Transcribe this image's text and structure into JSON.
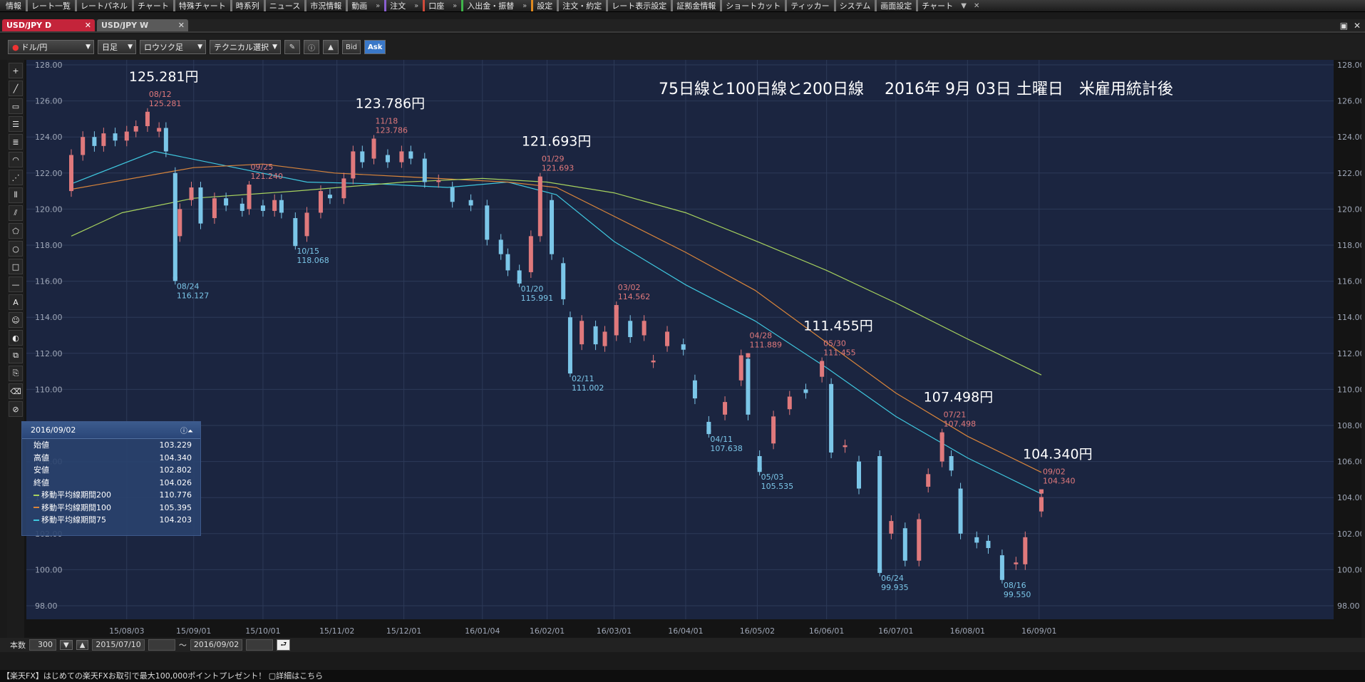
{
  "menu": [
    "情報",
    "レート一覧",
    "レートパネル",
    "チャート",
    "特殊チャート",
    "時系列",
    "ニュース",
    "市況情報",
    "動画",
    "注文",
    "口座",
    "入出金・振替",
    "設定",
    "注文・約定",
    "レート表示設定",
    "証拠金情報",
    "ショートカット",
    "ティッカー",
    "システム",
    "画面設定",
    "チャート"
  ],
  "tabs": [
    {
      "label": "USD/JPY D",
      "active": true
    },
    {
      "label": "USD/JPY W",
      "active": false
    }
  ],
  "toolbar": {
    "pair": "ドル/円",
    "period": "日足",
    "chart_kind": "ロウソク足",
    "technical": "テクニカル選択",
    "bid": "Bid",
    "ask": "Ask"
  },
  "chart_data": {
    "type": "candlestick",
    "title": "75日線と100日線と200日線　 2016年 9月 03日 土曜日　米雇用統計後",
    "ylim": [
      97,
      128.5
    ],
    "yticks": [
      "128.00",
      "126.00",
      "124.00",
      "122.00",
      "120.00",
      "118.00",
      "116.00",
      "114.00",
      "112.00",
      "110.00",
      "108.00",
      "106.00",
      "104.00",
      "102.00",
      "100.00",
      "98.00"
    ],
    "xtick_labels": [
      "15/08/03",
      "15/09/01",
      "15/10/01",
      "15/11/02",
      "15/12/01",
      "16/01/04",
      "16/02/01",
      "16/03/01",
      "16/04/01",
      "16/05/02",
      "16/06/01",
      "16/07/01",
      "16/08/01",
      "16/09/01"
    ],
    "x_start": "2015-07-10",
    "x_end": "2016-09-02",
    "colors": {
      "bg": "#1b2540",
      "up": "#e0797c",
      "down": "#7bc6e8",
      "ma75": "#3fc7de",
      "ma100": "#d9853b",
      "ma200": "#a7d25e",
      "grid": "#2d3a58",
      "axis": "#a0a8b8"
    },
    "series": [
      {
        "name": "移動平均線期間75",
        "points": [
          [
            "2015-07-10",
            121.4
          ],
          [
            "2015-08-15",
            123.2
          ],
          [
            "2015-09-15",
            122.4
          ],
          [
            "2015-10-20",
            121.5
          ],
          [
            "2015-11-20",
            121.4
          ],
          [
            "2015-12-20",
            121.2
          ],
          [
            "2016-01-15",
            121.5
          ],
          [
            "2016-02-05",
            120.8
          ],
          [
            "2016-03-01",
            118.2
          ],
          [
            "2016-04-01",
            115.8
          ],
          [
            "2016-05-01",
            113.8
          ],
          [
            "2016-06-01",
            111.2
          ],
          [
            "2016-07-01",
            108.5
          ],
          [
            "2016-08-01",
            106.2
          ],
          [
            "2016-09-02",
            104.2
          ]
        ]
      },
      {
        "name": "移動平均線期間100",
        "points": [
          [
            "2015-07-10",
            121.1
          ],
          [
            "2015-09-01",
            122.3
          ],
          [
            "2015-10-01",
            122.5
          ],
          [
            "2015-11-01",
            122.0
          ],
          [
            "2015-12-01",
            121.8
          ],
          [
            "2016-01-15",
            121.5
          ],
          [
            "2016-02-05",
            121.2
          ],
          [
            "2016-03-01",
            119.6
          ],
          [
            "2016-04-01",
            117.6
          ],
          [
            "2016-05-01",
            115.5
          ],
          [
            "2016-06-01",
            112.6
          ],
          [
            "2016-07-01",
            109.8
          ],
          [
            "2016-08-01",
            107.4
          ],
          [
            "2016-09-02",
            105.4
          ]
        ]
      },
      {
        "name": "移動平均線期間200",
        "points": [
          [
            "2015-07-10",
            118.5
          ],
          [
            "2015-08-01",
            119.8
          ],
          [
            "2015-09-01",
            120.6
          ],
          [
            "2015-10-15",
            121.0
          ],
          [
            "2015-12-01",
            121.5
          ],
          [
            "2016-01-04",
            121.7
          ],
          [
            "2016-02-01",
            121.5
          ],
          [
            "2016-03-01",
            120.9
          ],
          [
            "2016-04-01",
            119.8
          ],
          [
            "2016-05-02",
            118.2
          ],
          [
            "2016-06-01",
            116.6
          ],
          [
            "2016-07-01",
            114.8
          ],
          [
            "2016-08-01",
            112.8
          ],
          [
            "2016-09-02",
            110.8
          ]
        ]
      }
    ],
    "candles": [
      [
        "2015-07-10",
        121.0,
        123.0
      ],
      [
        "2015-07-15",
        123.0,
        124.0
      ],
      [
        "2015-07-20",
        124.0,
        123.5
      ],
      [
        "2015-07-24",
        123.5,
        124.2
      ],
      [
        "2015-07-29",
        124.2,
        123.8
      ],
      [
        "2015-08-03",
        123.8,
        124.3
      ],
      [
        "2015-08-07",
        124.3,
        124.6
      ],
      [
        "2015-08-12",
        124.6,
        125.28
      ],
      [
        "2015-08-17",
        124.3,
        124.5
      ],
      [
        "2015-08-20",
        124.5,
        123.2
      ],
      [
        "2015-08-24",
        122.0,
        116.13
      ],
      [
        "2015-08-26",
        118.5,
        120.0
      ],
      [
        "2015-08-31",
        120.5,
        121.2
      ],
      [
        "2015-09-04",
        121.2,
        119.2
      ],
      [
        "2015-09-10",
        119.5,
        120.6
      ],
      [
        "2015-09-15",
        120.6,
        120.2
      ],
      [
        "2015-09-22",
        120.3,
        119.9
      ],
      [
        "2015-09-25",
        120.0,
        121.24
      ],
      [
        "2015-10-01",
        120.2,
        119.9
      ],
      [
        "2015-10-06",
        119.9,
        120.5
      ],
      [
        "2015-10-09",
        120.5,
        119.8
      ],
      [
        "2015-10-15",
        119.5,
        118.07
      ],
      [
        "2015-10-20",
        118.5,
        119.8
      ],
      [
        "2015-10-26",
        119.8,
        121.0
      ],
      [
        "2015-10-30",
        120.8,
        120.6
      ],
      [
        "2015-11-05",
        120.6,
        121.7
      ],
      [
        "2015-11-09",
        121.7,
        123.2
      ],
      [
        "2015-11-13",
        123.2,
        122.6
      ],
      [
        "2015-11-18",
        122.8,
        123.79
      ],
      [
        "2015-11-24",
        123.0,
        122.6
      ],
      [
        "2015-11-30",
        122.6,
        123.2
      ],
      [
        "2015-12-04",
        123.2,
        122.8
      ],
      [
        "2015-12-10",
        122.8,
        121.5
      ],
      [
        "2015-12-16",
        121.5,
        121.6
      ],
      [
        "2015-12-22",
        121.2,
        120.4
      ],
      [
        "2015-12-30",
        120.5,
        120.2
      ],
      [
        "2016-01-06",
        120.2,
        118.3
      ],
      [
        "2016-01-12",
        118.3,
        117.5
      ],
      [
        "2016-01-15",
        117.5,
        116.6
      ],
      [
        "2016-01-20",
        116.6,
        115.99
      ],
      [
        "2016-01-25",
        116.5,
        118.5
      ],
      [
        "2016-01-29",
        118.5,
        121.69
      ],
      [
        "2016-02-03",
        120.5,
        117.5
      ],
      [
        "2016-02-08",
        117.0,
        115.0
      ],
      [
        "2016-02-11",
        114.0,
        111.0
      ],
      [
        "2016-02-16",
        112.5,
        113.8
      ],
      [
        "2016-02-22",
        113.5,
        112.5
      ],
      [
        "2016-02-26",
        112.4,
        113.2
      ],
      [
        "2016-03-02",
        113.0,
        114.56
      ],
      [
        "2016-03-08",
        113.8,
        112.9
      ],
      [
        "2016-03-14",
        113.0,
        113.8
      ],
      [
        "2016-03-18",
        111.5,
        111.6
      ],
      [
        "2016-03-24",
        112.4,
        113.2
      ],
      [
        "2016-03-31",
        112.5,
        112.2
      ],
      [
        "2016-04-05",
        110.5,
        109.5
      ],
      [
        "2016-04-11",
        108.2,
        107.64
      ],
      [
        "2016-04-18",
        108.6,
        109.3
      ],
      [
        "2016-04-25",
        110.5,
        111.89
      ],
      [
        "2016-04-28",
        111.7,
        108.6
      ],
      [
        "2016-05-03",
        106.3,
        105.54
      ],
      [
        "2016-05-09",
        107.0,
        108.5
      ],
      [
        "2016-05-16",
        108.9,
        109.6
      ],
      [
        "2016-05-23",
        110.0,
        109.8
      ],
      [
        "2016-05-30",
        110.7,
        111.46
      ],
      [
        "2016-06-03",
        110.3,
        106.5
      ],
      [
        "2016-06-09",
        106.8,
        106.9
      ],
      [
        "2016-06-15",
        106.0,
        104.5
      ],
      [
        "2016-06-24",
        106.3,
        99.94
      ],
      [
        "2016-06-29",
        102.0,
        102.7
      ],
      [
        "2016-07-05",
        102.3,
        100.5
      ],
      [
        "2016-07-11",
        100.5,
        102.8
      ],
      [
        "2016-07-15",
        104.6,
        105.3
      ],
      [
        "2016-07-21",
        106.0,
        107.5
      ],
      [
        "2016-07-25",
        106.3,
        105.5
      ],
      [
        "2016-07-29",
        104.5,
        102.0
      ],
      [
        "2016-08-05",
        101.8,
        101.5
      ],
      [
        "2016-08-10",
        101.6,
        101.2
      ],
      [
        "2016-08-16",
        100.8,
        99.55
      ],
      [
        "2016-08-22",
        100.3,
        100.4
      ],
      [
        "2016-08-26",
        100.3,
        101.8
      ],
      [
        "2016-09-02",
        103.23,
        104.03
      ]
    ],
    "annotations": [
      {
        "date": "08/12",
        "value": "125.281",
        "kind": "high",
        "x": "2015-08-12",
        "y": 125.28,
        "big": "125.281円"
      },
      {
        "date": "08/24",
        "value": "116.127",
        "kind": "low",
        "x": "2015-08-24",
        "y": 116.13
      },
      {
        "date": "09/25",
        "value": "121.240",
        "kind": "high",
        "x": "2015-09-25",
        "y": 121.24
      },
      {
        "date": "10/15",
        "value": "118.068",
        "kind": "low",
        "x": "2015-10-15",
        "y": 118.07
      },
      {
        "date": "11/18",
        "value": "123.786",
        "kind": "high",
        "x": "2015-11-18",
        "y": 123.79,
        "big": "123.786円"
      },
      {
        "date": "01/29",
        "value": "121.693",
        "kind": "high",
        "x": "2016-01-29",
        "y": 121.69,
        "big": "121.693円"
      },
      {
        "date": "01/20",
        "value": "115.991",
        "kind": "low",
        "x": "2016-01-20",
        "y": 115.99
      },
      {
        "date": "02/11",
        "value": "111.002",
        "kind": "low",
        "x": "2016-02-11",
        "y": 111.0
      },
      {
        "date": "03/02",
        "value": "114.562",
        "kind": "high",
        "x": "2016-03-02",
        "y": 114.56
      },
      {
        "date": "04/11",
        "value": "107.638",
        "kind": "low",
        "x": "2016-04-11",
        "y": 107.64
      },
      {
        "date": "04/28",
        "value": "111.889",
        "kind": "high",
        "x": "2016-04-28",
        "y": 111.89
      },
      {
        "date": "05/03",
        "value": "105.535",
        "kind": "low",
        "x": "2016-05-03",
        "y": 105.54
      },
      {
        "date": "05/30",
        "value": "111.455",
        "kind": "high",
        "x": "2016-05-30",
        "y": 111.46,
        "big": "111.455円"
      },
      {
        "date": "06/24",
        "value": "99.935",
        "kind": "low",
        "x": "2016-06-24",
        "y": 99.94
      },
      {
        "date": "07/21",
        "value": "107.498",
        "kind": "high",
        "x": "2016-07-21",
        "y": 107.5,
        "big": "107.498円"
      },
      {
        "date": "08/16",
        "value": "99.550",
        "kind": "low",
        "x": "2016-08-16",
        "y": 99.55
      },
      {
        "date": "09/02",
        "value": "104.340",
        "kind": "high",
        "x": "2016-09-02",
        "y": 104.34,
        "big": "104.340円"
      }
    ]
  },
  "infobox": {
    "date": "2016/09/02",
    "rows": [
      {
        "label": "始値",
        "value": "103.229",
        "color": ""
      },
      {
        "label": "高値",
        "value": "104.340",
        "color": ""
      },
      {
        "label": "安値",
        "value": "102.802",
        "color": ""
      },
      {
        "label": "終値",
        "value": "104.026",
        "color": ""
      },
      {
        "label": "移動平均線期間200",
        "value": "110.776",
        "color": "#a7d25e"
      },
      {
        "label": "移動平均線期間100",
        "value": "105.395",
        "color": "#d9853b"
      },
      {
        "label": "移動平均線期間75",
        "value": "104.203",
        "color": "#3fc7de"
      }
    ]
  },
  "bottom": {
    "label": "本数",
    "count": "300",
    "from": "2015/07/10",
    "tilde": "〜",
    "to": "2016/09/02"
  },
  "status": "【楽天FX】はじめての楽天FXお取引で最大100,000ポイントプレゼント！ ▢詳細はこちら"
}
